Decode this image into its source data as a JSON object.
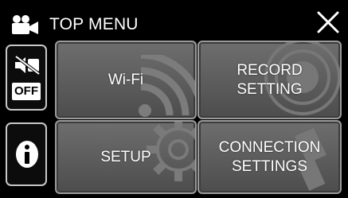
{
  "header": {
    "title": "TOP MENU",
    "icon": "movie-camera-icon",
    "close_icon": "close-icon"
  },
  "sidebar": {
    "sound_toggle": {
      "icon": "silent-mode-icon",
      "state_label": "OFF"
    },
    "info_button": {
      "icon": "info-icon"
    }
  },
  "tiles": [
    {
      "id": "wifi",
      "lines": [
        "Wi-Fi"
      ],
      "icon": "wifi-icon"
    },
    {
      "id": "record",
      "lines": [
        "RECORD",
        "SETTING"
      ],
      "icon": "record-icon"
    },
    {
      "id": "setup",
      "lines": [
        "SETUP"
      ],
      "icon": "gear-icon"
    },
    {
      "id": "connection",
      "lines": [
        "CONNECTION",
        "SETTINGS"
      ],
      "icon": "connection-icon"
    }
  ],
  "colors": {
    "background": "#000000",
    "tile": "#5f5f5f",
    "tile_border": "#9a9a9a",
    "text": "#ffffff"
  }
}
